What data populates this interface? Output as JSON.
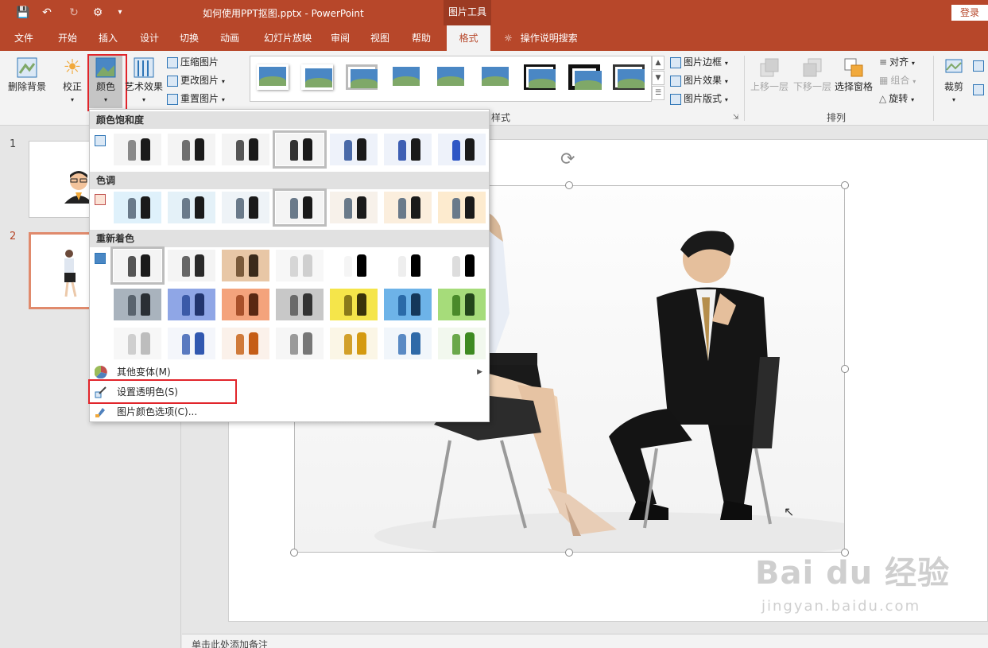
{
  "window": {
    "doc_title": "如何使用PPT抠图.pptx  -  PowerPoint",
    "context_tab_group": "图片工具",
    "login": "登录"
  },
  "tabs": [
    "文件",
    "开始",
    "插入",
    "设计",
    "切换",
    "动画",
    "幻灯片放映",
    "审阅",
    "视图",
    "帮助",
    "格式"
  ],
  "active_tab": "格式",
  "tell_me": "操作说明搜索",
  "ribbon": {
    "remove_bg": "删除背景",
    "corrections": "校正",
    "color": "颜色",
    "artistic": "艺术效果",
    "compress": "压缩图片",
    "change_picture": "更改图片",
    "reset_picture": "重置图片",
    "picture_border": "图片边框",
    "picture_effects": "图片效果",
    "picture_layout": "图片版式",
    "styles_group": "样式",
    "bring_forward": "上移一层",
    "send_backward": "下移一层",
    "selection_pane": "选择窗格",
    "align": "对齐",
    "group": "组合",
    "rotate": "旋转",
    "arrange_group": "排列",
    "crop": "裁剪"
  },
  "slides": [
    {
      "number": "1"
    },
    {
      "number": "2"
    }
  ],
  "notes_placeholder": "单击此处添加备注",
  "color_menu": {
    "saturation_header": "颜色饱和度",
    "tone_header": "色调",
    "recolor_header": "重新着色",
    "more_variations": "其他变体(M)",
    "set_transparent": "设置透明色(S)",
    "color_options": "图片颜色选项(C)..."
  },
  "colors": {
    "accent": "#b7472a",
    "highlight": "#e1252b"
  },
  "watermark": {
    "brand": "Bai du 经验",
    "url": "jingyan.baidu.com"
  }
}
